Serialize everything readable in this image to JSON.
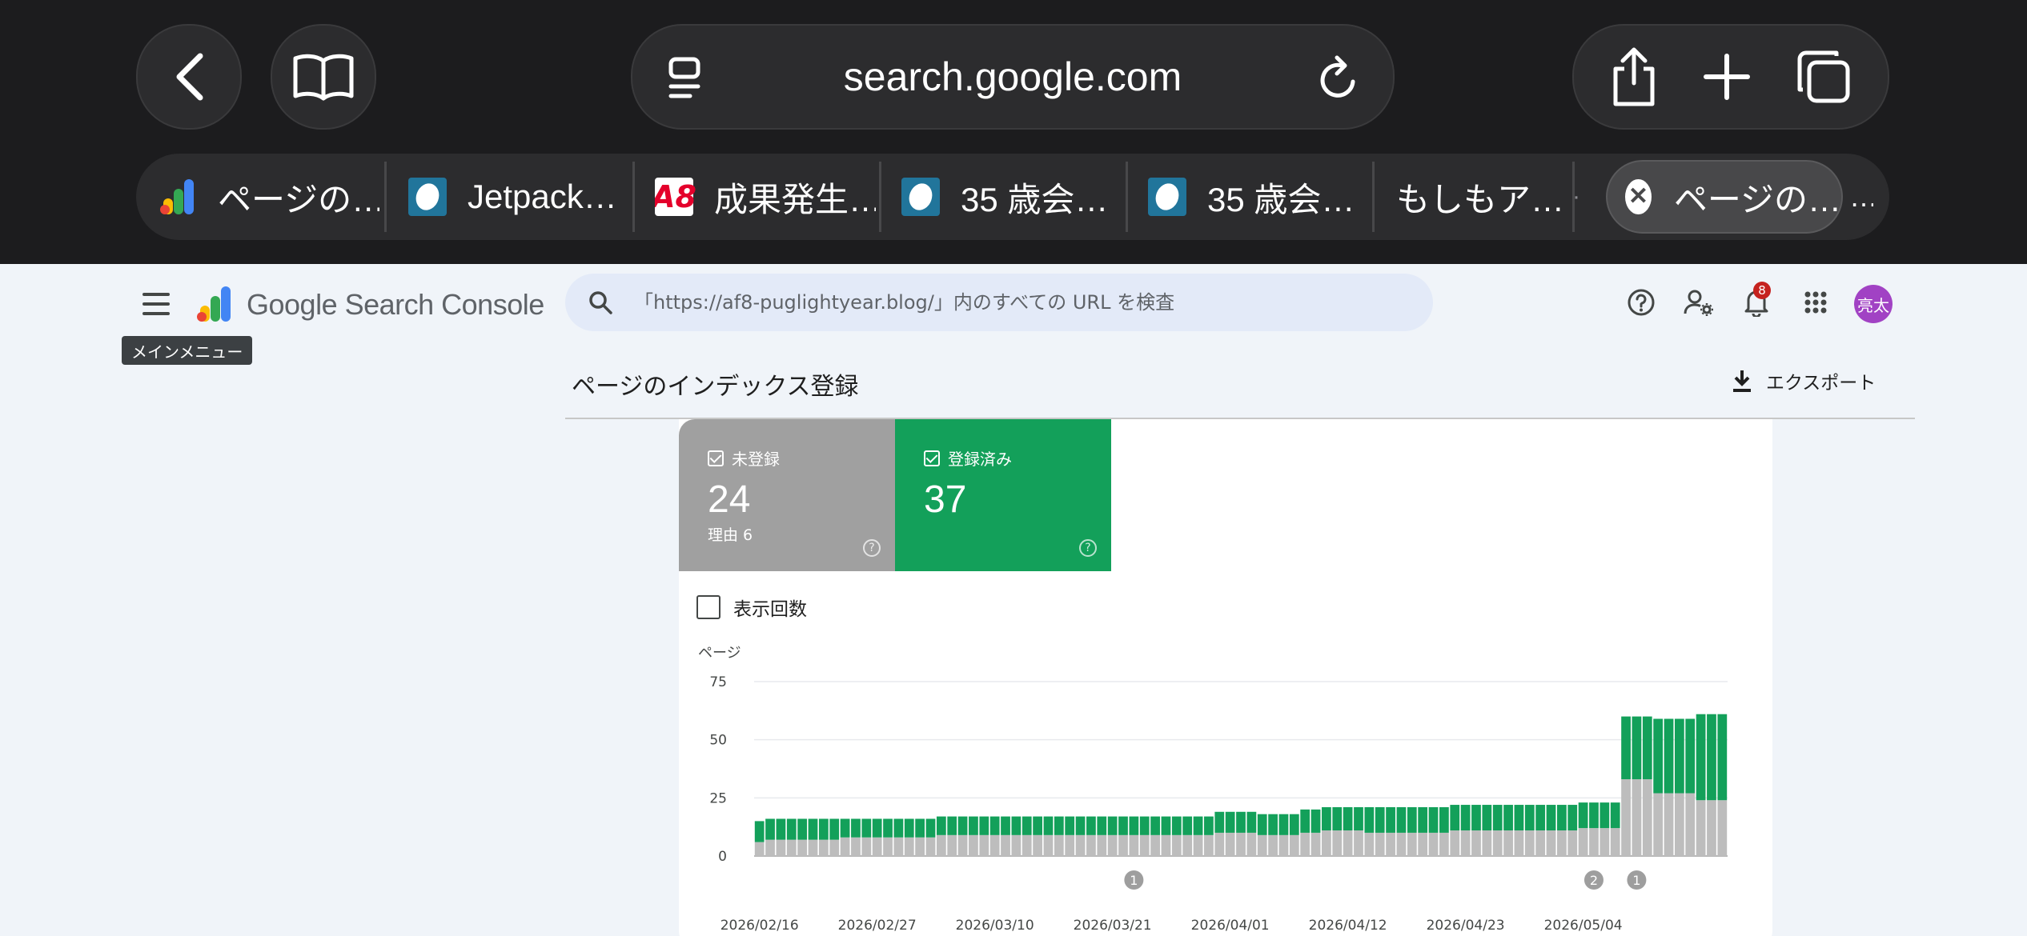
{
  "browser": {
    "address": "search.google.com",
    "tabs": [
      {
        "label": "ページの…",
        "icon": "search-console-icon"
      },
      {
        "label": "Jetpack…",
        "icon": "wordpress-icon"
      },
      {
        "label": "成果発生…",
        "icon": "a8-icon"
      },
      {
        "label": "35 歳会…",
        "icon": "wordpress-icon"
      },
      {
        "label": "35 歳会…",
        "icon": "wordpress-icon"
      },
      {
        "label": "もしもア…",
        "icon": "google-icon"
      },
      {
        "label": "ページの…",
        "icon": "close-icon",
        "active": true
      }
    ],
    "a8_glyph": "A8",
    "overflow_glyph": "…",
    "close_glyph": "✕"
  },
  "header": {
    "product": "Google Search Console",
    "menu_tooltip": "メインメニュー",
    "search_placeholder": "「https://af8-puglightyear.blog/」内のすべての URL を検査",
    "notification_count": "8",
    "avatar_initials": "亮太"
  },
  "report": {
    "title": "ページのインデックス登録",
    "export_label": "エクスポート",
    "metrics": [
      {
        "label": "未登録",
        "value": "24",
        "sub": "理由 6",
        "color": "#a0a0a0"
      },
      {
        "label": "登録済み",
        "value": "37",
        "color": "#13a05a"
      }
    ],
    "help_glyph": "?",
    "impressions_label": "表示回数"
  },
  "chart_data": {
    "type": "bar",
    "stacked": true,
    "ylabel": "ページ",
    "ylim": [
      0,
      75
    ],
    "yticks": [
      0,
      25,
      50,
      75
    ],
    "xticks": [
      "2026/02/16",
      "2026/02/27",
      "2026/03/10",
      "2026/03/21",
      "2026/04/01",
      "2026/04/12",
      "2026/04/23",
      "2026/05/04"
    ],
    "x_start": "2026/02/16",
    "x_end": "2026/05/10",
    "series": [
      {
        "name": "未登録",
        "color": "#bdbdbd",
        "values": [
          6,
          7,
          7,
          7,
          7,
          7,
          7,
          7,
          8,
          8,
          8,
          8,
          8,
          8,
          8,
          8,
          8,
          9,
          9,
          9,
          9,
          9,
          9,
          9,
          9,
          9,
          9,
          9,
          9,
          9,
          9,
          9,
          9,
          9,
          9,
          9,
          9,
          9,
          9,
          9,
          9,
          9,
          9,
          10,
          10,
          10,
          10,
          9,
          9,
          9,
          9,
          10,
          10,
          11,
          11,
          11,
          11,
          10,
          10,
          10,
          10,
          10,
          10,
          10,
          10,
          11,
          11,
          11,
          11,
          11,
          11,
          11,
          11,
          11,
          11,
          11,
          11,
          12,
          12,
          12,
          12,
          33,
          33,
          33,
          27,
          27,
          27,
          27,
          24,
          24,
          24
        ]
      },
      {
        "name": "登録済み",
        "color": "#13a05a",
        "values": [
          9,
          9,
          9,
          9,
          9,
          9,
          9,
          9,
          8,
          8,
          8,
          8,
          8,
          8,
          8,
          8,
          8,
          8,
          8,
          8,
          8,
          8,
          8,
          8,
          8,
          8,
          8,
          8,
          8,
          8,
          8,
          8,
          8,
          8,
          8,
          8,
          8,
          8,
          8,
          8,
          8,
          8,
          8,
          9,
          9,
          9,
          9,
          9,
          9,
          9,
          9,
          10,
          10,
          10,
          10,
          10,
          10,
          11,
          11,
          11,
          11,
          11,
          11,
          11,
          11,
          11,
          11,
          11,
          11,
          11,
          11,
          11,
          11,
          11,
          11,
          11,
          11,
          11,
          11,
          11,
          11,
          27,
          27,
          27,
          32,
          32,
          32,
          32,
          37,
          37,
          37
        ]
      }
    ],
    "annotations": [
      {
        "date": "2026/03/23",
        "label": "1"
      },
      {
        "date": "2026/05/05",
        "label": "2"
      },
      {
        "date": "2026/05/09",
        "label": "1"
      }
    ]
  }
}
